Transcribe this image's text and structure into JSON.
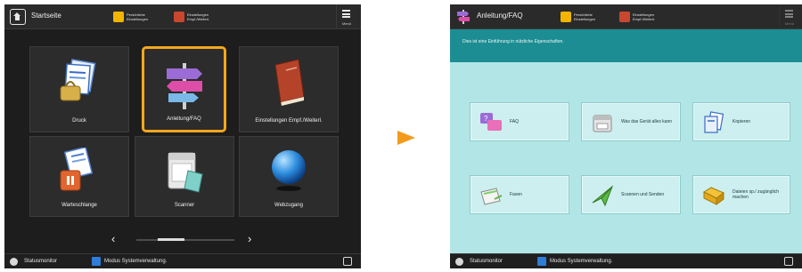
{
  "left_screen": {
    "topbar": {
      "title": "Startseite",
      "quick_buttons": [
        {
          "label": "Persönliche Einstellungen",
          "color": "#f3b400"
        },
        {
          "label": "Einstellungen Empf./Weiterl.",
          "color": "#c8472e"
        }
      ],
      "menu_label": "Menü"
    },
    "tiles": [
      {
        "label": "Druck"
      },
      {
        "label": "Anleitung/FAQ"
      },
      {
        "label": "Einstellungen Empf./Weiterl."
      },
      {
        "label": "Warteschlange"
      },
      {
        "label": "Scanner"
      },
      {
        "label": "Webzugang"
      }
    ],
    "pager": {
      "prev": "‹",
      "next": "›",
      "position": 0.4
    },
    "statusbar": {
      "status_label": "Statusmonitor",
      "mode_label": "Modus Systemverwaltung."
    }
  },
  "right_screen": {
    "topbar": {
      "title": "Anleitung/FAQ",
      "quick_buttons": [
        {
          "label": "Persönliche Einstellungen",
          "color": "#f3b400"
        },
        {
          "label": "Einstellungen Empf./Weiterl.",
          "color": "#c8472e"
        }
      ],
      "menu_label": "Menü"
    },
    "banner": "Dies ist eine Einführung in nützliche Eigenschaften.",
    "functions": [
      {
        "label": "FAQ"
      },
      {
        "label": "Was das Gerät alles kann"
      },
      {
        "label": "Kopieren"
      },
      {
        "label": "Faxen"
      },
      {
        "label": "Scannen und Senden"
      },
      {
        "label": "Dateien sp./ zugänglich machen"
      }
    ],
    "statusbar": {
      "status_label": "Statusmonitor",
      "mode_label": "Modus Systemverwaltung."
    }
  },
  "colors": {
    "selection": "#f3a71d",
    "transition_arrow": "#f39a1d",
    "banner": "#1c8d93",
    "content_bg": "#b2e6e6"
  }
}
